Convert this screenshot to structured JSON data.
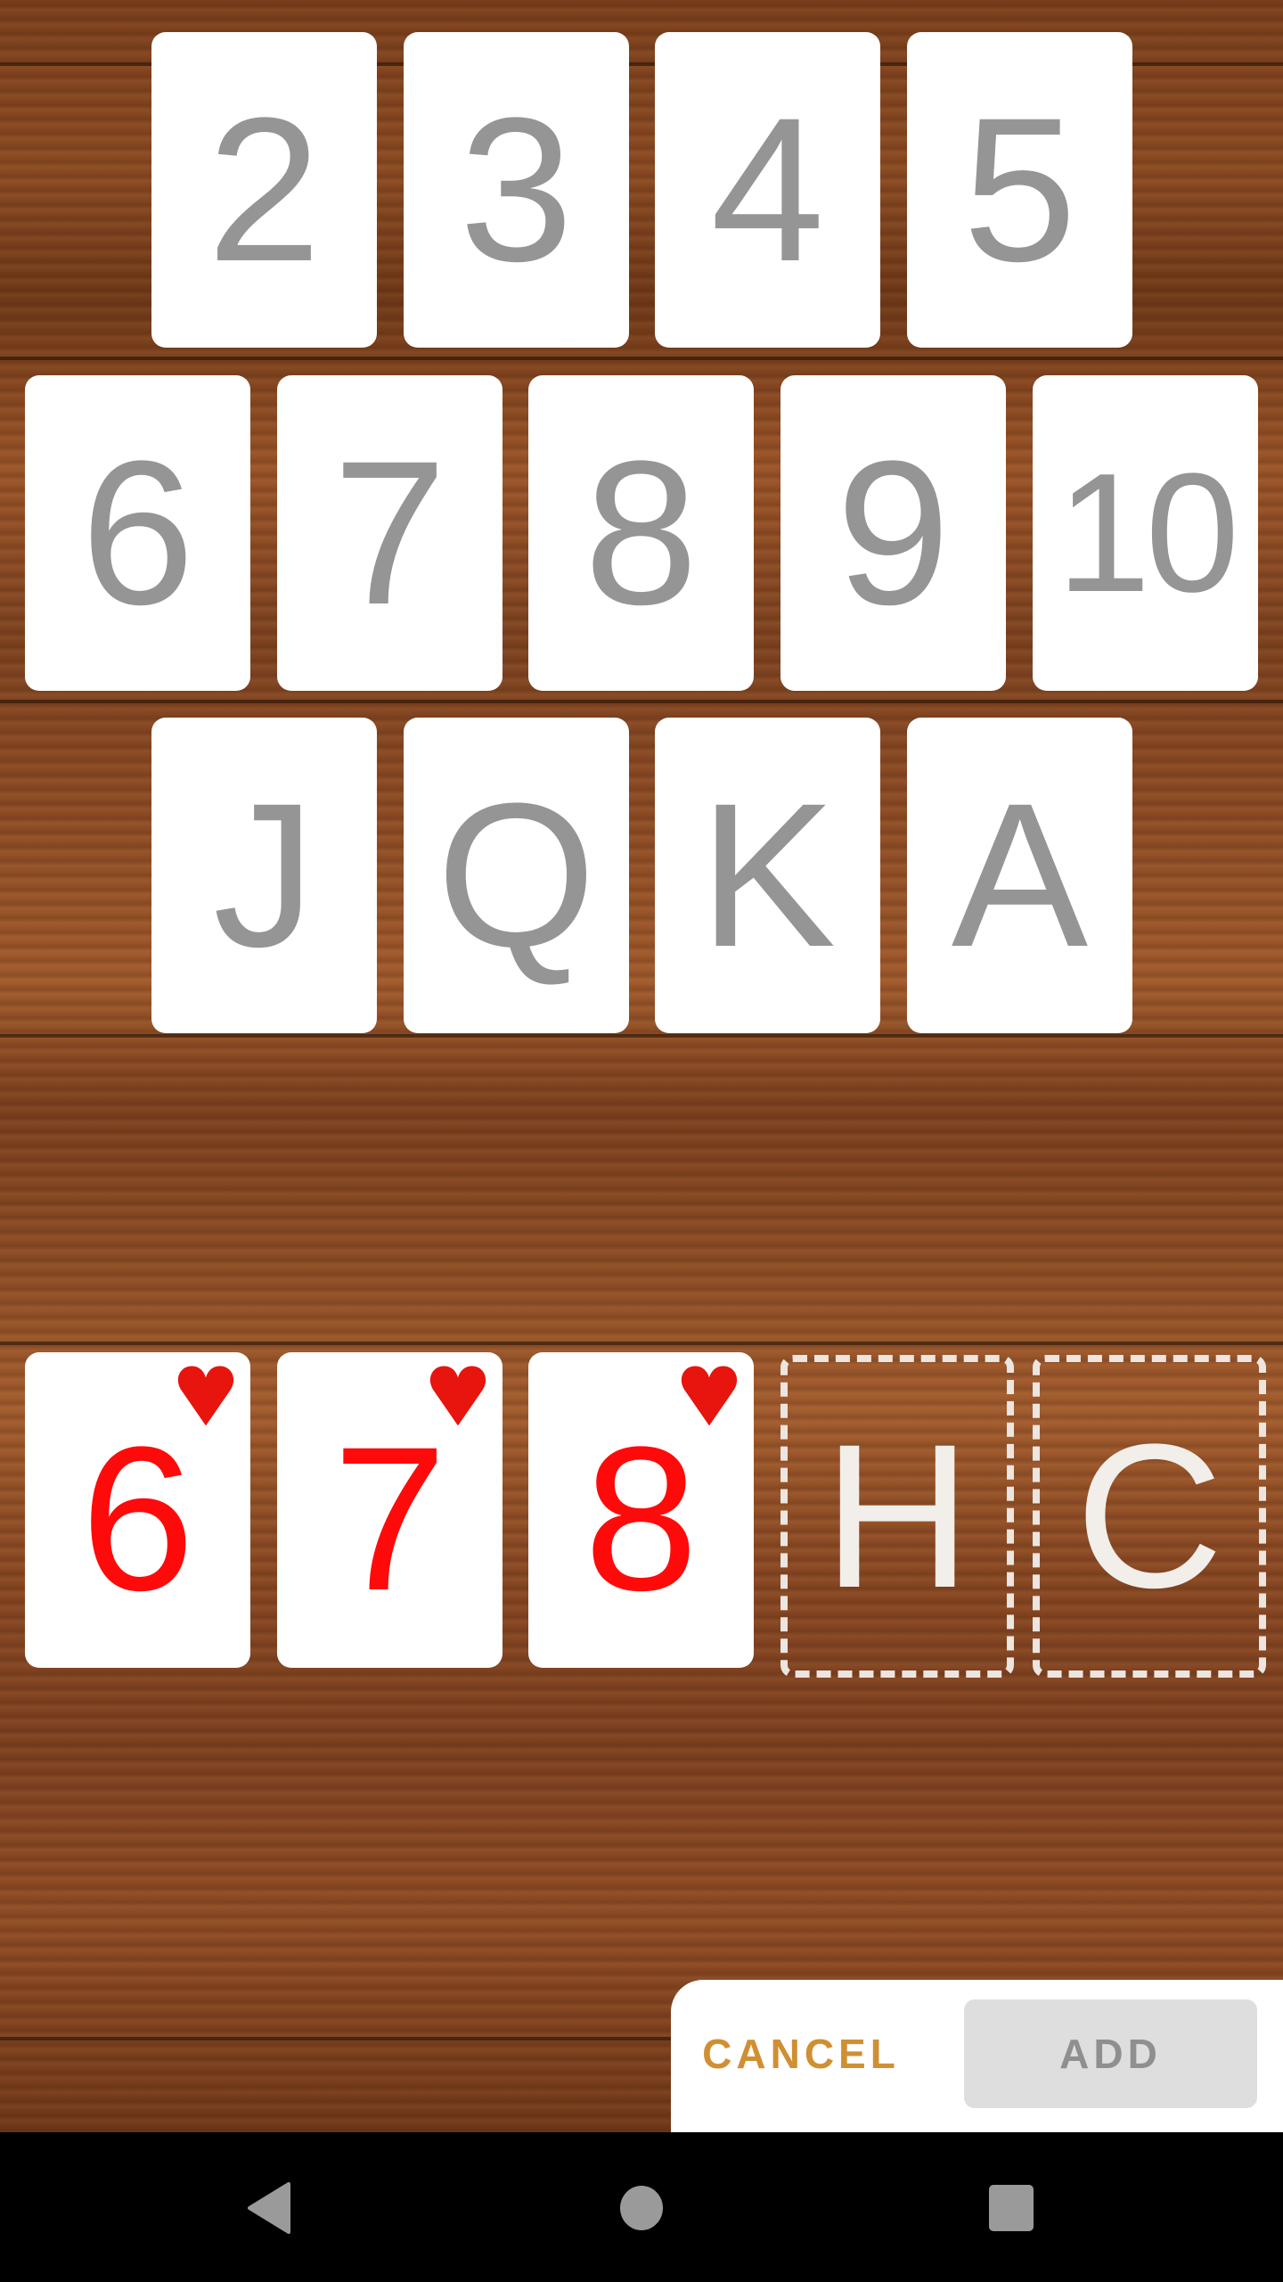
{
  "rank_picker": {
    "rows": [
      [
        "2",
        "3",
        "4",
        "5"
      ],
      [
        "6",
        "7",
        "8",
        "9",
        "10"
      ],
      [
        "J",
        "Q",
        "K",
        "A"
      ]
    ]
  },
  "selection": {
    "cards": [
      {
        "rank": "6",
        "suit": "heart-icon"
      },
      {
        "rank": "7",
        "suit": "heart-icon"
      },
      {
        "rank": "8",
        "suit": "heart-icon"
      }
    ],
    "empty_slots": [
      "H",
      "C"
    ]
  },
  "colors": {
    "rank_gray": "#959595",
    "heart_red": "#e8140e",
    "selected_rank_red": "#ff0a0a",
    "cancel_accent": "#d08f33",
    "add_disabled_bg": "#dedede"
  },
  "dialog": {
    "cancel_label": "CANCEL",
    "add_label": "ADD"
  },
  "navbar": {
    "icons": [
      "back-icon",
      "home-icon",
      "recents-icon"
    ]
  }
}
